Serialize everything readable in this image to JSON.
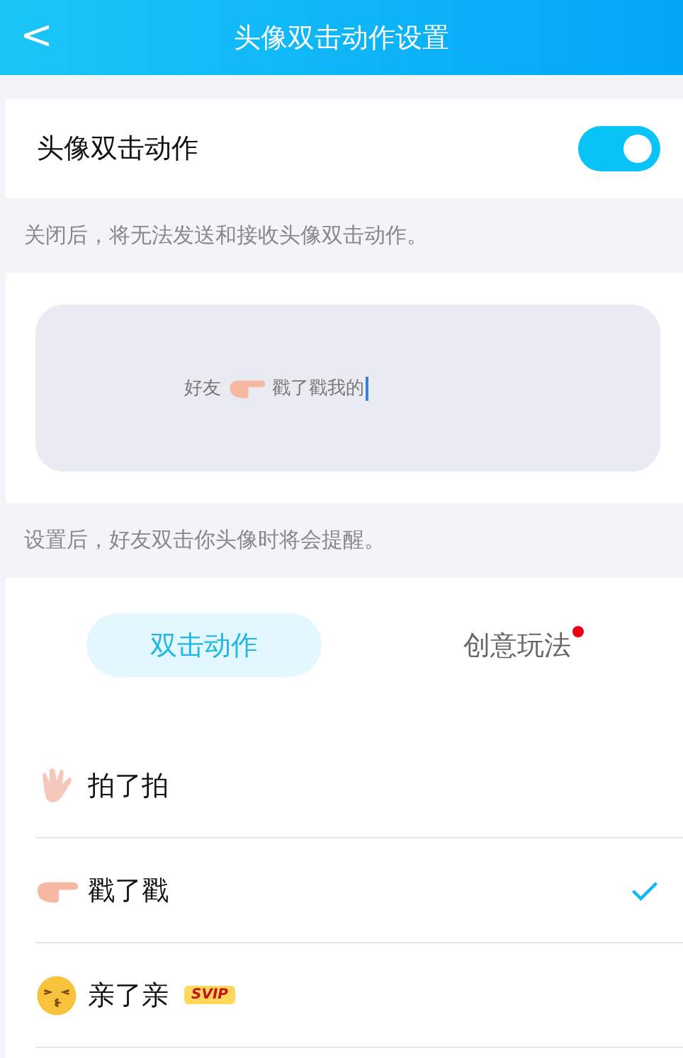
{
  "header": {
    "back": "<",
    "title": "头像双击动作设置"
  },
  "toggle_row": {
    "label": "头像双击动作",
    "on": true
  },
  "toggle_note": "关闭后，将无法发送和接收头像双击动作。",
  "preview": {
    "before": "好友",
    "kind": "poke",
    "after": "戳了戳我的"
  },
  "preview_note": "设置后，好友双击你头像时将会提醒。",
  "tabs": [
    {
      "label": "双击动作",
      "selected": true,
      "dot": false
    },
    {
      "label": "创意玩法",
      "selected": false,
      "dot": true
    }
  ],
  "actions": [
    {
      "kind": "wave",
      "label": "拍了拍",
      "selected": false
    },
    {
      "kind": "poke",
      "label": "戳了戳",
      "selected": true
    },
    {
      "kind": "kiss",
      "label": "亲了亲",
      "selected": false,
      "badge": "SVIP"
    }
  ]
}
